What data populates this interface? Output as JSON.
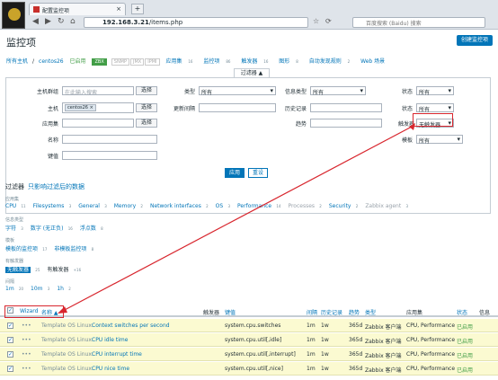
{
  "browser": {
    "tab_title": "配置监控项",
    "url_host": "192.168.3.21",
    "url_path": "/items.php",
    "search_placeholder": "百度搜索 (Baidu) 搜索"
  },
  "page": {
    "title": "监控项",
    "create_button": "创建监控项"
  },
  "breadcrumb": {
    "all_hosts": "所有主机",
    "host": "centos26",
    "enabled": "已启用",
    "zbx": "ZBX",
    "snmp": "SNMP",
    "jmx": "JMX",
    "ipmi": "IPMI",
    "applications": "应用集",
    "applications_count": "16",
    "items": "监控项",
    "items_count": "86",
    "triggers": "触发器",
    "triggers_count": "16",
    "graphs": "图形",
    "graphs_count": "8",
    "discovery": "自动发现规则",
    "discovery_count": "2",
    "web": "Web 场景"
  },
  "filter": {
    "tab": "过滤器 ▲",
    "host_group_label": "主机群组",
    "host_group_placeholder": "在此输入搜索",
    "select": "选择",
    "type_label": "类型",
    "type_value": "所有",
    "info_type_label": "信息类型",
    "info_type_value": "所有",
    "status_label": "状态",
    "status_value": "所有",
    "host_label": "主机",
    "host_chip": "centos26",
    "update_label": "更新间隔",
    "history_label": "历史记录",
    "state_label": "状态",
    "state_value": "所有",
    "app_label": "应用集",
    "trends_label": "趋势",
    "triggers_label": "触发器",
    "triggers_value": "无触发器",
    "template_label": "模板",
    "template_value": "所有",
    "name_label": "名称",
    "key_label": "键值",
    "apply": "应用",
    "reset": "重设"
  },
  "subfilter": {
    "title": "过滤器",
    "hint": "只影响过滤后的数据",
    "apps_head": "应用集",
    "apps": [
      {
        "n": "CPU",
        "c": "11"
      },
      {
        "n": "Filesystems",
        "c": "3"
      },
      {
        "n": "General",
        "c": "3"
      },
      {
        "n": "Memory",
        "c": "2"
      },
      {
        "n": "Network interfaces",
        "c": "2"
      },
      {
        "n": "OS",
        "c": "3"
      },
      {
        "n": "Performance",
        "c": "14"
      },
      {
        "n": "Processes",
        "c": "2"
      },
      {
        "n": "Security",
        "c": "2"
      },
      {
        "n": "Zabbix agent",
        "c": "3"
      }
    ],
    "types_head": "信息类型",
    "types": [
      {
        "n": "字符",
        "c": "3"
      },
      {
        "n": "数字 (无正负)",
        "c": "16"
      },
      {
        "n": "浮点数",
        "c": "8"
      }
    ],
    "tpl_head": "模板",
    "tpl": [
      {
        "n": "模板的监控项",
        "c": "17"
      },
      {
        "n": "非模板监控项",
        "c": "8"
      }
    ],
    "trig_head": "有触发器",
    "trig": [
      {
        "n": "无触发器",
        "c": "25"
      },
      {
        "n": "有触发器",
        "c": "+16"
      }
    ],
    "int_head": "间隔",
    "ints": [
      {
        "n": "1m",
        "c": "20"
      },
      {
        "n": "10m",
        "c": "3"
      },
      {
        "n": "1h",
        "c": "2"
      }
    ]
  },
  "table": {
    "headers": {
      "wizard": "Wizard",
      "name": "名称 ▲",
      "triggers": "触发器",
      "key": "键值",
      "interval": "间隔",
      "history": "历史记录",
      "trends": "趋势",
      "type": "类型",
      "apps": "应用集",
      "status": "状态",
      "info": "信息"
    },
    "rows": [
      {
        "tpl": "Template OS Linux:",
        "name": "Context switches per second",
        "key": "system.cpu.switches",
        "interval": "1m",
        "history": "1w",
        "trends": "365d",
        "type": "Zabbix 客户端",
        "apps": "CPU, Performance",
        "status": "已启用"
      },
      {
        "tpl": "Template OS Linux:",
        "name": "CPU idle time",
        "key": "system.cpu.util[,idle]",
        "interval": "1m",
        "history": "1w",
        "trends": "365d",
        "type": "Zabbix 客户端",
        "apps": "CPU, Performance",
        "status": "已启用"
      },
      {
        "tpl": "Template OS Linux:",
        "name": "CPU interrupt time",
        "key": "system.cpu.util[,interrupt]",
        "interval": "1m",
        "history": "1w",
        "trends": "365d",
        "type": "Zabbix 客户端",
        "apps": "CPU, Performance",
        "status": "已启用"
      },
      {
        "tpl": "Template OS Linux:",
        "name": "CPU nice time",
        "key": "system.cpu.util[,nice]",
        "interval": "1m",
        "history": "1w",
        "trends": "365d",
        "type": "Zabbix 客户端",
        "apps": "CPU, Performance",
        "status": "已启用"
      }
    ]
  },
  "colors": {
    "accent": "#0275b8",
    "annotation": "#d8262e",
    "row_highlight": "#fbfad1"
  }
}
